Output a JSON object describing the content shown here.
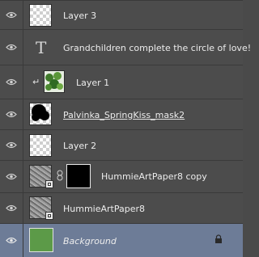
{
  "layers": [
    {
      "name": "Layer 3"
    },
    {
      "name": "Grandchildren complete the circle of love!"
    },
    {
      "name": "Layer 1"
    },
    {
      "name": "Palvinka_SpringKiss_mask2"
    },
    {
      "name": "Layer 2"
    },
    {
      "name": "HummieArtPaper8 copy"
    },
    {
      "name": "HummieArtPaper8"
    },
    {
      "name": "Background"
    }
  ],
  "icons": {
    "visibility": "eye-icon",
    "text_layer": "T",
    "clipping": "↵",
    "link": "chain-icon",
    "lock": "lock-icon"
  },
  "colors": {
    "panel": "#4c4c4c",
    "selected_row": "#6d7c97",
    "background_fill": "#5c9a48"
  }
}
